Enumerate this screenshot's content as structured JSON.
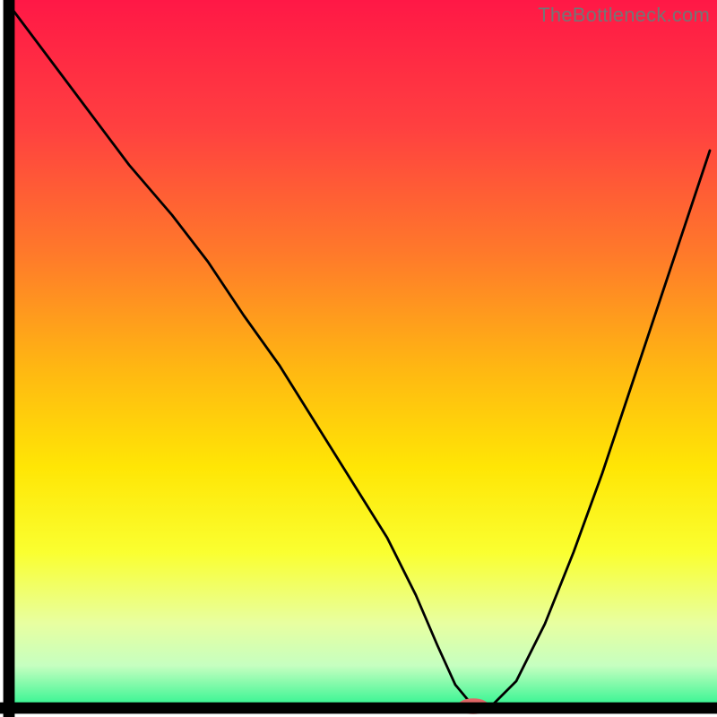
{
  "watermark": "TheBottleneck.com",
  "chart_data": {
    "type": "line",
    "title": "",
    "xlabel": "",
    "ylabel": "",
    "xlim": [
      0,
      100
    ],
    "ylim": [
      0,
      100
    ],
    "grid": false,
    "legend": null,
    "background": {
      "gradient_stops": [
        {
          "pos": 0.0,
          "color": "#ff1846"
        },
        {
          "pos": 0.18,
          "color": "#ff4040"
        },
        {
          "pos": 0.36,
          "color": "#ff7a2a"
        },
        {
          "pos": 0.52,
          "color": "#ffb712"
        },
        {
          "pos": 0.66,
          "color": "#ffe605"
        },
        {
          "pos": 0.78,
          "color": "#faff30"
        },
        {
          "pos": 0.88,
          "color": "#e8ffa0"
        },
        {
          "pos": 0.94,
          "color": "#c6ffc0"
        },
        {
          "pos": 1.0,
          "color": "#2bf48f"
        }
      ]
    },
    "series": [
      {
        "name": "bottleneck-curve",
        "color": "#000000",
        "x": [
          1.5,
          6,
          12,
          18,
          24,
          29,
          34,
          39,
          44,
          49,
          54,
          58,
          61,
          63.5,
          66,
          68.5,
          72,
          76,
          80,
          84,
          88,
          92,
          96,
          99
        ],
        "y": [
          99,
          93,
          85,
          77,
          70,
          63.5,
          56,
          49,
          41,
          33,
          25,
          17,
          10,
          4.5,
          1.5,
          1.5,
          5,
          13,
          23,
          34,
          46,
          58,
          70,
          79
        ]
      }
    ],
    "marker": {
      "name": "minimum-marker",
      "color": "#e06666",
      "cx": 66,
      "cy": 1.5,
      "rx": 2.2,
      "ry": 1.1
    },
    "axes": {
      "color": "#000000",
      "left_x": 1.25,
      "bottom_y": 1.25,
      "thickness": 1.6
    }
  }
}
